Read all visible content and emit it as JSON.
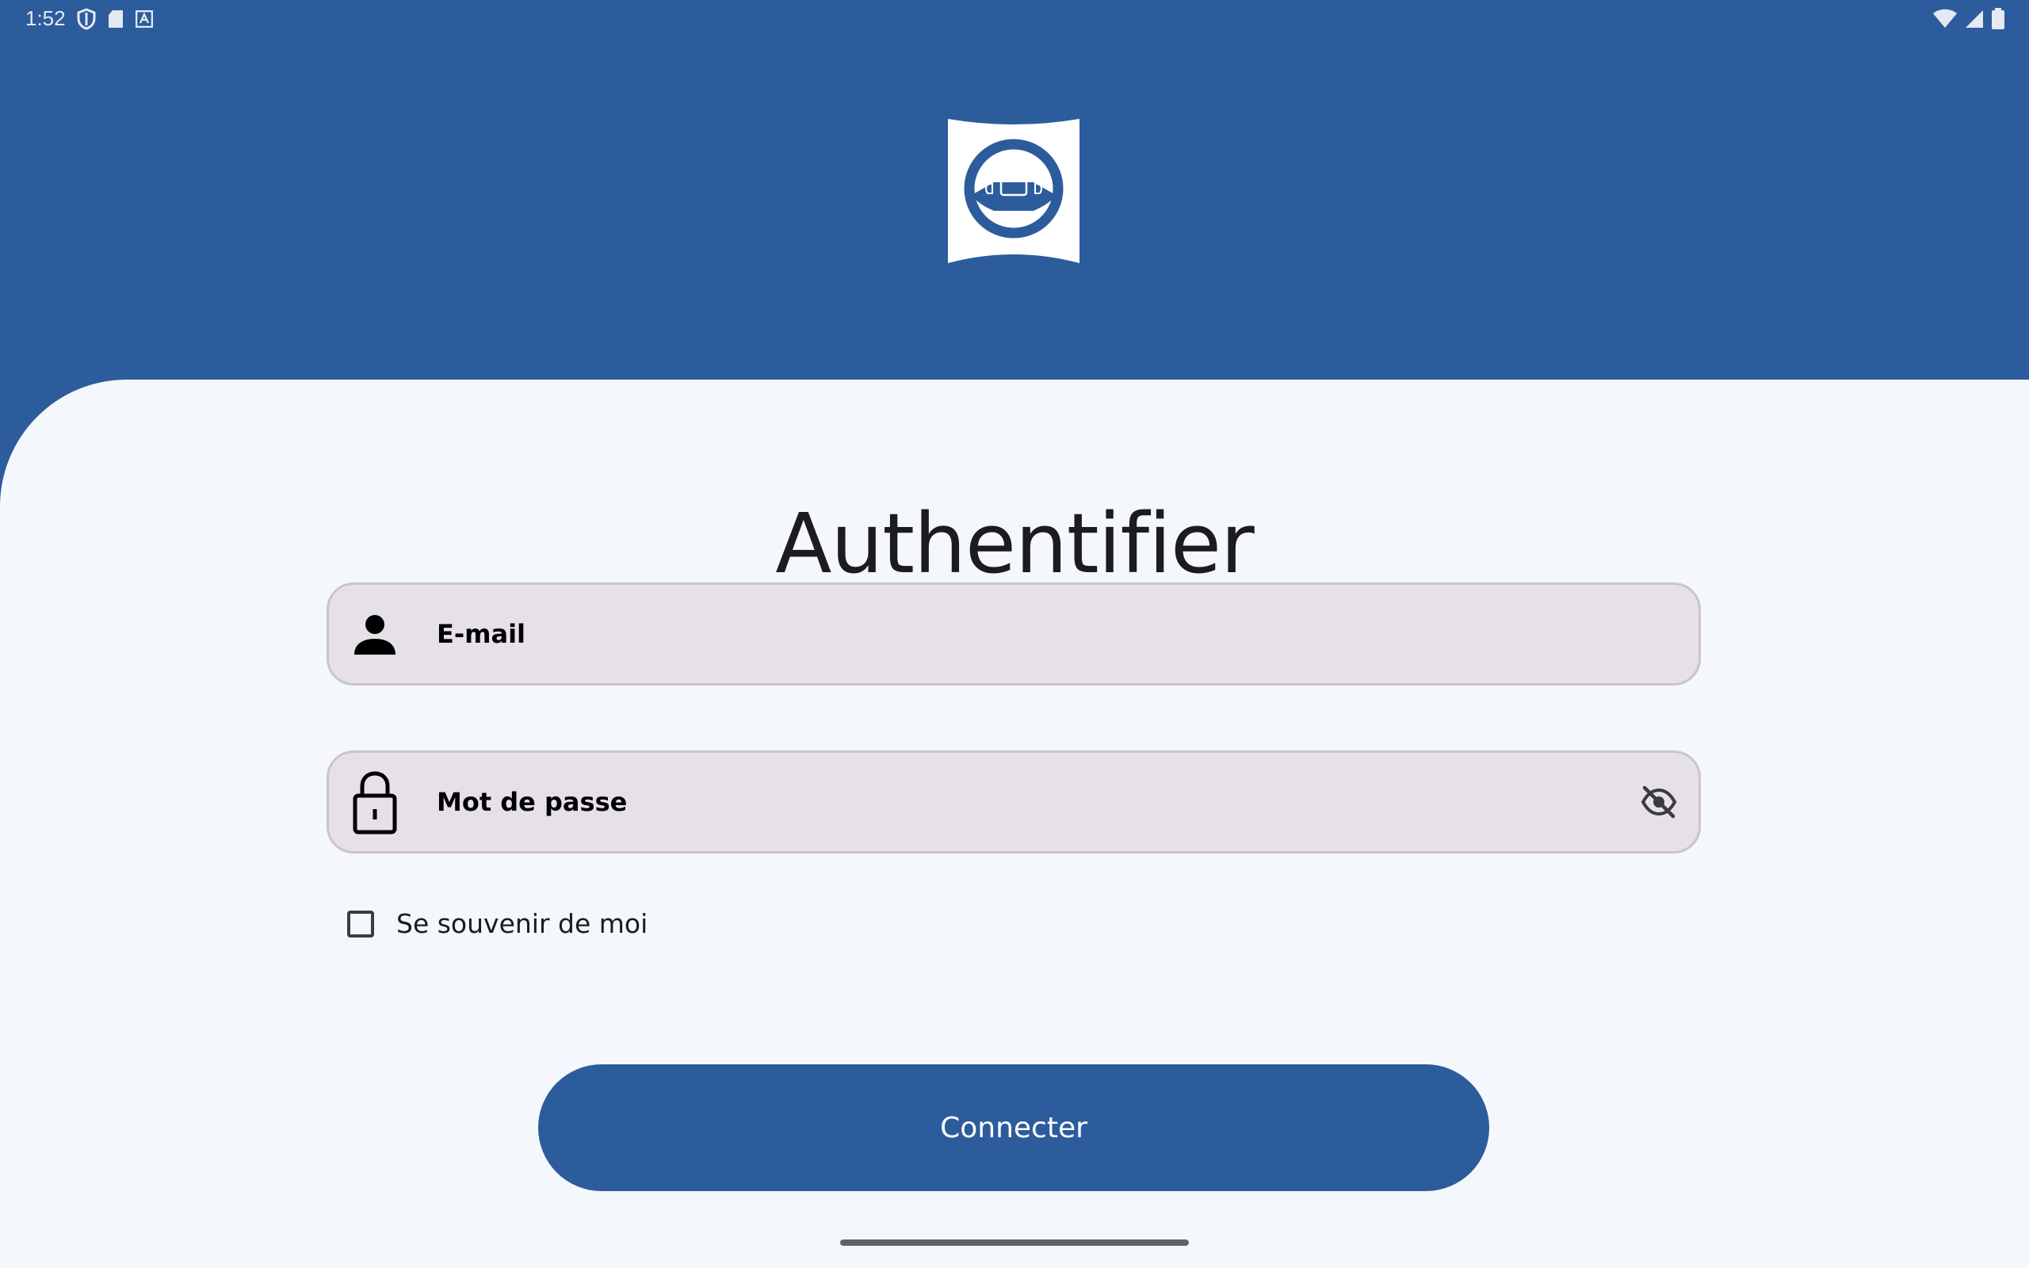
{
  "status_bar": {
    "time": "1:52",
    "left_icons": [
      "shield-icon",
      "sd-card-icon",
      "keyboard-icon"
    ],
    "right_icons": [
      "wifi-icon",
      "cell-signal-icon",
      "battery-icon"
    ]
  },
  "logo": {
    "icon": "steering-wheel-icon",
    "colors": {
      "background": "#ffffff",
      "mark": "#2c5c9c"
    }
  },
  "login": {
    "title": "Authentifier",
    "email": {
      "icon": "person-icon",
      "placeholder": "E-mail",
      "value": ""
    },
    "password": {
      "icon": "lock-icon",
      "placeholder": "Mot de passe",
      "value": "",
      "toggle_icon": "eye-off-icon"
    },
    "remember_me": {
      "label": "Se souvenir de moi",
      "checked": false
    },
    "submit_label": "Connecter"
  },
  "colors": {
    "brand": "#2c5c9c",
    "panel_background": "#f4f7fc",
    "field_background": "#e6e0e8",
    "field_border": "#cac4cf",
    "text": "#1c1b1f"
  }
}
